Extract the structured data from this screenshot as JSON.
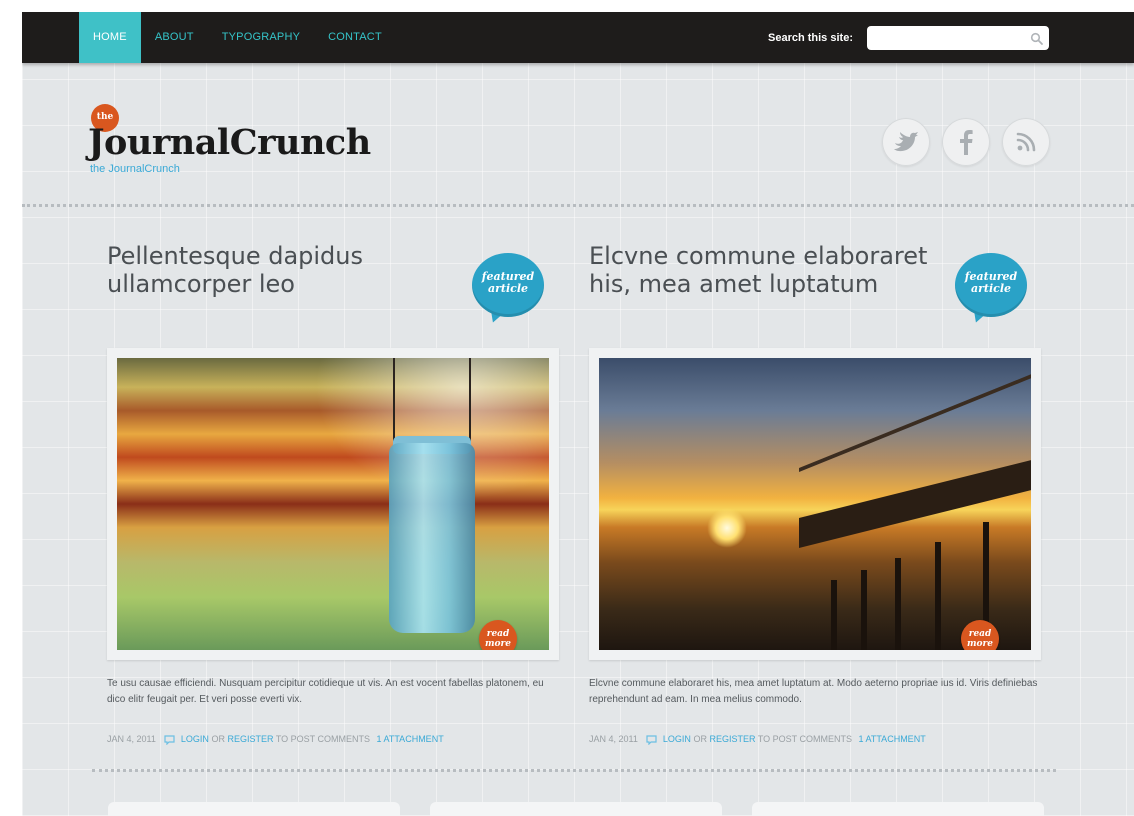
{
  "nav": {
    "items": [
      {
        "label": "HOME",
        "active": true
      },
      {
        "label": "ABOUT",
        "active": false
      },
      {
        "label": "TYPOGRAPHY",
        "active": false
      },
      {
        "label": "CONTACT",
        "active": false
      }
    ]
  },
  "search": {
    "label": "Search this site:",
    "placeholder": "",
    "icon": "search-icon"
  },
  "header": {
    "badge": "the",
    "logo": "JournalCrunch",
    "tagline": "the JournalCrunch",
    "social": [
      {
        "name": "twitter-icon"
      },
      {
        "name": "facebook-icon"
      },
      {
        "name": "rss-icon"
      }
    ]
  },
  "colors": {
    "accent": "#3fc1c7",
    "orange": "#d9571f",
    "featured_blue": "#2aa2c7",
    "link": "#3aa9d6"
  },
  "articles": [
    {
      "title": "Pellentesque dapidus ullamcorper leo",
      "featured_line1": "featured",
      "featured_line2": "article",
      "read_line1": "read",
      "read_line2": "more",
      "excerpt": "Te usu causae efficiendi. Nusquam percipitur cotidieque ut vis. An est vocent fabellas platonem, eu dico elitr feugait per. Et veri posse everti vix.",
      "date": "JAN 4, 2011",
      "login": "LOGIN",
      "or": "OR",
      "register": "REGISTER",
      "post_comments": "TO POST COMMENTS",
      "attachment": "1 ATTACHMENT"
    },
    {
      "title": "Elcvne commune elaboraret his, mea amet luptatum",
      "featured_line1": "featured",
      "featured_line2": "article",
      "read_line1": "read",
      "read_line2": "more",
      "excerpt": "Elcvne commune elaboraret his, mea amet luptatum at. Modo aeterno propriae ius id. Viris definiebas reprehendunt ad eam. In mea melius commodo.",
      "date": "JAN 4, 2011",
      "login": "LOGIN",
      "or": "OR",
      "register": "REGISTER",
      "post_comments": "TO POST COMMENTS",
      "attachment": "1 ATTACHMENT"
    }
  ]
}
